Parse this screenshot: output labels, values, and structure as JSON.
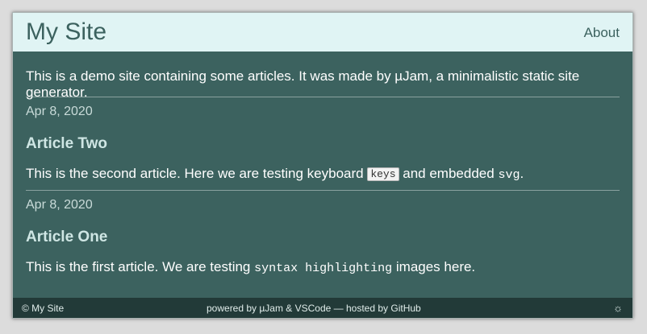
{
  "header": {
    "site_title": "My Site",
    "nav_about": "About"
  },
  "intro": "This is a demo site containing some articles. It was made by µJam, a minimalistic static site generator.",
  "articles": [
    {
      "date": "Apr 8, 2020",
      "title": "Article Two",
      "body_part1": "This is the second article. Here we are testing keyboard ",
      "kbd": "keys",
      "body_part2": " and embedded ",
      "code": "svg",
      "body_part3": "."
    },
    {
      "date": "Apr 8, 2020",
      "title": "Article One",
      "body_part1": "This is the first article. We are testing ",
      "code": "syntax highlighting",
      "body_part2": " images here."
    }
  ],
  "footer": {
    "copyright": "© My Site",
    "credits": "powered by µJam & VSCode — hosted by GitHub",
    "theme_toggle_icon": "sun-icon",
    "theme_toggle_glyph": "☼"
  },
  "colors": {
    "header_bg": "#e0f4f4",
    "page_bg": "#3c625f",
    "footer_bg": "#223a38"
  }
}
